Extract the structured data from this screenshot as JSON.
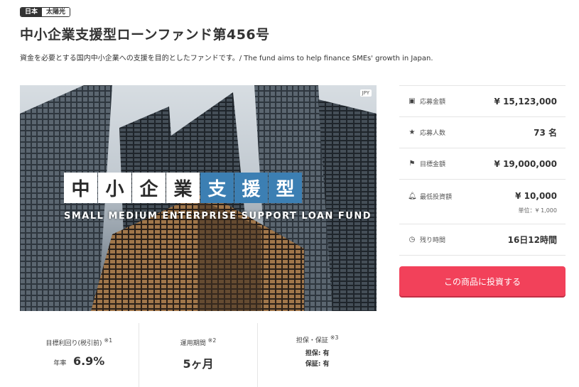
{
  "tags": {
    "country": "日本",
    "category": "太陽光"
  },
  "title": "中小企業支援型ローンファンド第456号",
  "description": "資金を必要とする国内中小企業への支援を目的としたファンドです。/ The fund aims to help finance SMEs' growth in Japan.",
  "hero": {
    "currency_badge": "JPY",
    "title_chars": [
      "中",
      "小",
      "企",
      "業",
      "支",
      "援",
      "型"
    ],
    "subtitle": "SMALL MEDIUM ENTERPRISE SUPPORT LOAN FUND"
  },
  "info": {
    "applied_amount": {
      "label": "応募金額",
      "value": "¥ 15,123,000",
      "icon": "money-icon"
    },
    "applicants": {
      "label": "応募人数",
      "value": "73 名",
      "icon": "star-icon"
    },
    "target_amount": {
      "label": "目標金額",
      "value": "¥ 19,000,000",
      "icon": "flag-icon"
    },
    "min_investment": {
      "label": "最低投資額",
      "value": "¥ 10,000",
      "unit": "単位：¥ 1,000",
      "icon": "bell-icon"
    },
    "time_left": {
      "label": "残り時間",
      "value": "16日12時間",
      "icon": "clock-icon"
    }
  },
  "cta_label": "この商品に投資する",
  "stats": {
    "yield": {
      "label": "目標利回り(税引前)",
      "note": "※1",
      "prefix": "年率",
      "value": "6.9%"
    },
    "period": {
      "label": "運用期間",
      "note": "※2",
      "value": "5ヶ月"
    },
    "collateral": {
      "label": "担保・保証",
      "note": "※3",
      "line1": "担保: 有",
      "line2": "保証: 有"
    }
  },
  "colors": {
    "cta": "#f2415a",
    "accent_blue": "#3c7fb3"
  }
}
